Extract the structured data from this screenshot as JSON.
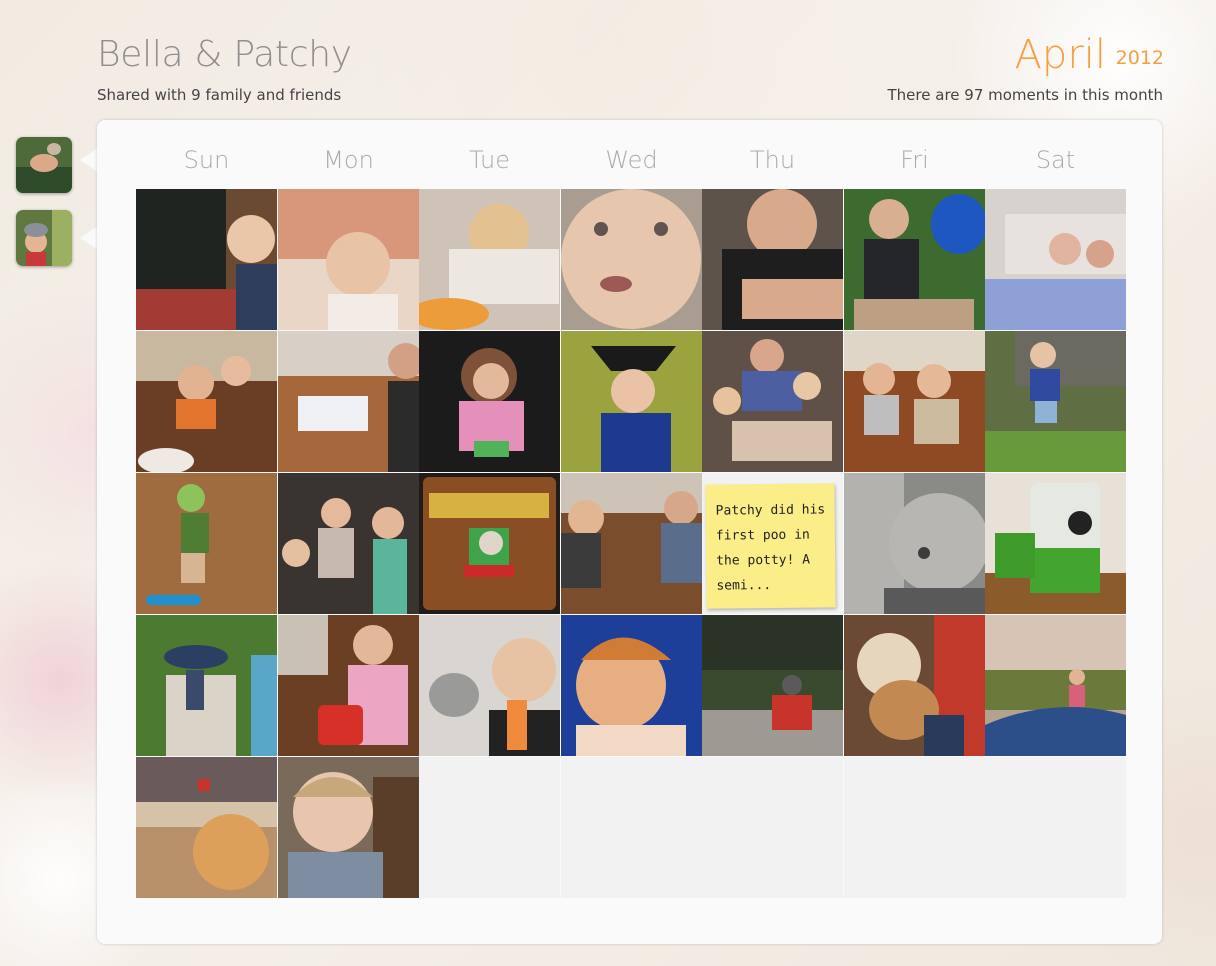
{
  "header": {
    "title": "Bella & Patchy",
    "shared_with": "Shared with 9 family and friends",
    "month": "April",
    "year": "2012",
    "moments": "There are 97 moments in this month"
  },
  "colors": {
    "accent": "#f5a040",
    "note": "#fbed87"
  },
  "sidebar": {
    "avatars": [
      {
        "icon": "child-photo-avatar"
      },
      {
        "icon": "child-photo-avatar"
      }
    ]
  },
  "weekdays": [
    "Sun",
    "Mon",
    "Tue",
    "Wed",
    "Thu",
    "Fri",
    "Sat"
  ],
  "note": "Patchy did his first poo in the potty! A semi..."
}
